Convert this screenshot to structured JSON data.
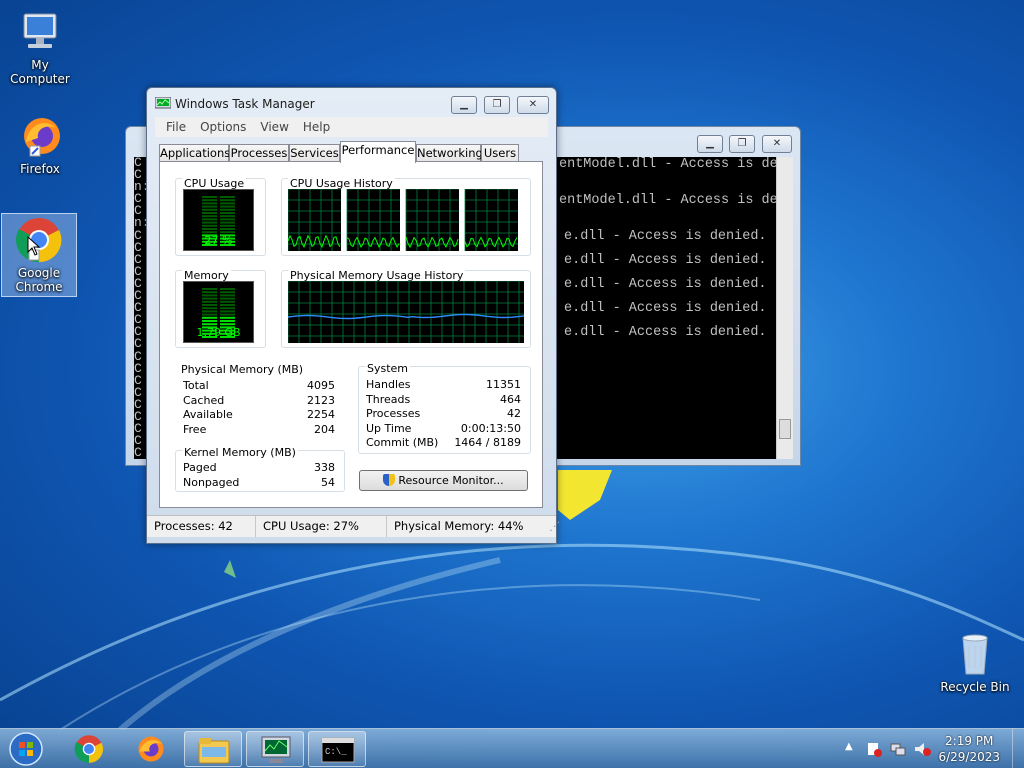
{
  "desktop": {
    "icons": [
      {
        "label": "My Computer"
      },
      {
        "label": "Firefox"
      },
      {
        "label": "Google Chrome"
      },
      {
        "label": "Recycle Bin"
      }
    ]
  },
  "cmd": {
    "lines": [
      "C",
      "C",
      "n:",
      "C",
      "C",
      "n:",
      "C",
      "C",
      "C",
      "C",
      "C",
      "C",
      "C",
      "C",
      "C",
      "C",
      "C",
      "C",
      "C",
      "C",
      "C",
      "C",
      "C",
      "C",
      "C",
      "C",
      "C",
      "C",
      "C",
      "C",
      "C",
      "C",
      "C",
      "C",
      "C",
      "C",
      "C",
      "C",
      "C",
      "C",
      "C",
      "C",
      "C",
      "C",
      "C"
    ],
    "visible_lines": [
      "entModel.dll - Access is de",
      "entModel.dll - Access is de",
      "e.dll - Access is denied.",
      "e.dll - Access is denied.",
      "e.dll - Access is denied.",
      "e.dll - Access is denied.",
      "e.dll - Access is denied."
    ]
  },
  "taskmgr": {
    "title": "Windows Task Manager",
    "menu": [
      "File",
      "Options",
      "View",
      "Help"
    ],
    "tabs": [
      "Applications",
      "Processes",
      "Services",
      "Performance",
      "Networking",
      "Users"
    ],
    "active_tab": "Performance",
    "cpu_usage_label": "CPU Usage",
    "cpu_usage_value": "27 %",
    "cpu_percent": 27,
    "cpu_history_label": "CPU Usage History",
    "memory_label": "Memory",
    "memory_value": "1.79 GB",
    "memory_percent": 44,
    "mem_history_label": "Physical Memory Usage History",
    "physical_memory": {
      "title": "Physical Memory (MB)",
      "rows": [
        {
          "k": "Total",
          "v": "4095"
        },
        {
          "k": "Cached",
          "v": "2123"
        },
        {
          "k": "Available",
          "v": "2254"
        },
        {
          "k": "Free",
          "v": "204"
        }
      ]
    },
    "kernel_memory": {
      "title": "Kernel Memory (MB)",
      "rows": [
        {
          "k": "Paged",
          "v": "338"
        },
        {
          "k": "Nonpaged",
          "v": "54"
        }
      ]
    },
    "system": {
      "title": "System",
      "rows": [
        {
          "k": "Handles",
          "v": "11351"
        },
        {
          "k": "Threads",
          "v": "464"
        },
        {
          "k": "Processes",
          "v": "42"
        },
        {
          "k": "Up Time",
          "v": "0:00:13:50"
        },
        {
          "k": "Commit (MB)",
          "v": "1464 / 8189"
        }
      ]
    },
    "resource_monitor_button": "Resource Monitor...",
    "status": {
      "processes": "Processes: 42",
      "cpu": "CPU Usage: 27%",
      "memory": "Physical Memory: 44%"
    }
  },
  "taskbar": {
    "time": "2:19 PM",
    "date": "6/29/2023"
  },
  "colors": {
    "graph_green": "#00ff00",
    "mem_line": "#2f8cff",
    "grid": "#008040"
  }
}
